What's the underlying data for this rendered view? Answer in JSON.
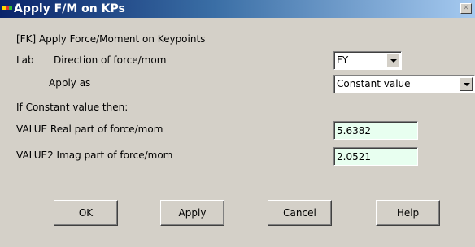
{
  "window": {
    "title": "Apply F/M on KPs",
    "icon": "ansys-app-icon",
    "close_icon": "close-icon",
    "close_glyph": "×"
  },
  "form": {
    "command": "[FK]  Apply Force/Moment on Keypoints",
    "lab_label": "Lab",
    "direction_label": "Direction of force/mom",
    "direction_value": "FY",
    "apply_as_label": "Apply as",
    "apply_as_value": "Constant value",
    "if_constant_label": "If Constant value then:",
    "value_label": "VALUE   Real part of force/mom",
    "value": "5.6382",
    "value2_label": "VALUE2  Imag part of force/mom",
    "value2": "2.0521"
  },
  "buttons": {
    "ok": "OK",
    "apply": "Apply",
    "cancel": "Cancel",
    "help": "Help"
  },
  "colors": {
    "title_start": "#0a246a",
    "title_end": "#a6caf0",
    "dialog_bg": "#d4d0c8",
    "input_bg": "#e8fff0"
  }
}
